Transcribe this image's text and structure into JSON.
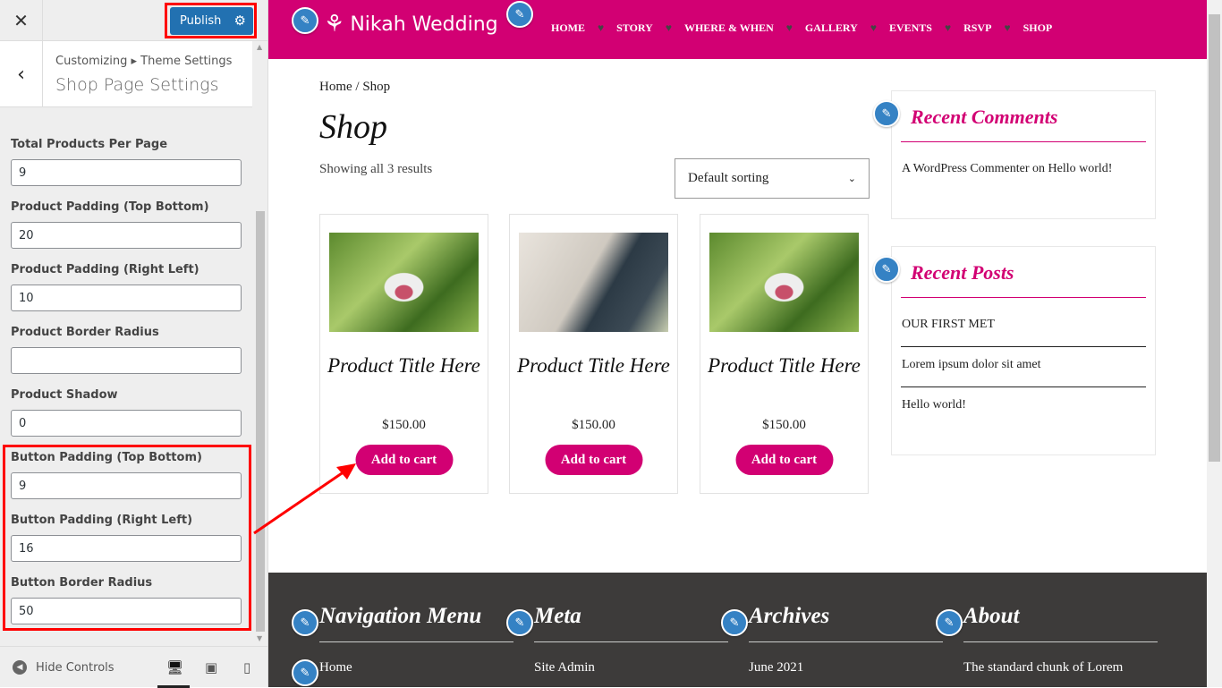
{
  "customizer": {
    "close_icon": "close-icon",
    "publish_label": "Publish",
    "breadcrumb": "Customizing ▸ Theme Settings",
    "section_title": "Shop Page Settings",
    "fields": [
      {
        "label": "Total Products Per Page",
        "value": "9"
      },
      {
        "label": "Product Padding (Top Bottom)",
        "value": "20"
      },
      {
        "label": "Product Padding (Right Left)",
        "value": "10"
      },
      {
        "label": "Product Border Radius",
        "value": ""
      },
      {
        "label": "Product Shadow",
        "value": "0"
      },
      {
        "label": "Button Padding (Top Bottom)",
        "value": "9"
      },
      {
        "label": "Button Padding (Right Left)",
        "value": "16"
      },
      {
        "label": "Button Border Radius",
        "value": "50"
      }
    ],
    "hide_controls": "Hide Controls",
    "devices": [
      "desktop",
      "tablet",
      "mobile"
    ]
  },
  "site": {
    "brand_color": "#d20073",
    "logo_text": "Nikah Wedding",
    "nav": [
      "HOME",
      "STORY",
      "WHERE & WHEN",
      "GALLERY",
      "EVENTS",
      "RSVP",
      "SHOP"
    ],
    "breadcrumb": "Home / Shop",
    "page_title": "Shop",
    "result_count": "Showing all 3 results",
    "sort_value": "Default sorting",
    "products": [
      {
        "title": "Product Title Here",
        "price": "$150.00",
        "button": "Add to cart",
        "image": "forest"
      },
      {
        "title": "Product Title Here",
        "price": "$150.00",
        "button": "Add to cart",
        "image": "hands"
      },
      {
        "title": "Product Title Here",
        "price": "$150.00",
        "button": "Add to cart",
        "image": "forest"
      }
    ],
    "recent_comments": {
      "title": "Recent Comments",
      "items": [
        "A WordPress Commenter on Hello world!"
      ]
    },
    "recent_posts": {
      "title": "Recent Posts",
      "items": [
        "OUR FIRST MET",
        "Lorem ipsum dolor sit amet",
        "Hello world!"
      ]
    },
    "footer": [
      {
        "title": "Navigation Menu",
        "item": "Home"
      },
      {
        "title": "Meta",
        "item": "Site Admin"
      },
      {
        "title": "Archives",
        "item": "June 2021"
      },
      {
        "title": "About",
        "item": "The standard chunk of Lorem"
      }
    ]
  }
}
